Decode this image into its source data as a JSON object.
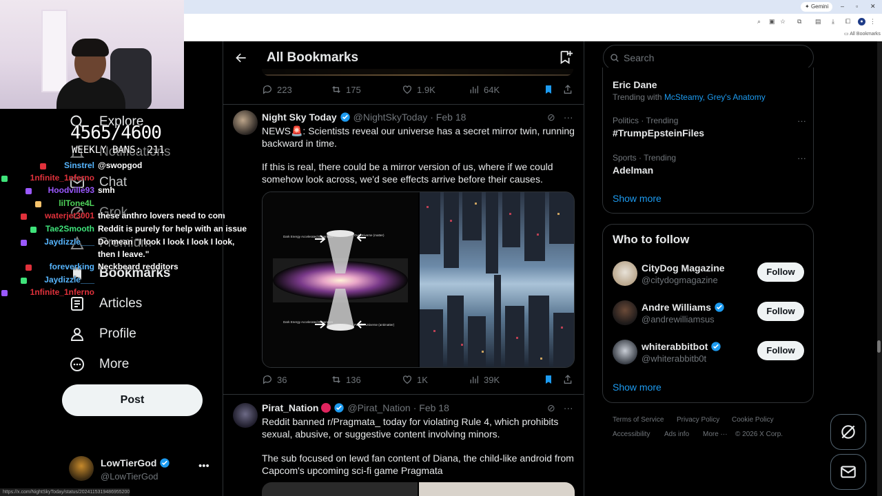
{
  "browser": {
    "gemini_label": "Gemini",
    "bookmarks_label": "All Bookmarks"
  },
  "overlay": {
    "counter": "4565/4600",
    "weekly": "WEEKLY BANS: 211"
  },
  "chat": [
    {
      "user": "Sinstrel",
      "user_color": "#57b6ff",
      "msg": "@swopgod"
    },
    {
      "user": "1nfinite_1nferno",
      "user_color": "#e0313b",
      "msg": ""
    },
    {
      "user": "Hoodville93",
      "user_color": "#9b59ff",
      "msg": "smh"
    },
    {
      "user": "lilTone4L",
      "user_color": "#4fd35a",
      "msg": ""
    },
    {
      "user": "waterjet3001",
      "user_color": "#e0313b",
      "msg": "these anthro lovers need to com"
    },
    {
      "user": "Tae2Smooth",
      "user_color": "#3fe37a",
      "msg": "Reddit is purely for help with an issue"
    },
    {
      "user": "Jaydizzle___",
      "user_color": "#57b6ff",
      "msg": "Do mean \"I look I look I look I look,"
    },
    {
      "user": "",
      "user_color": "#ffffff",
      "msg": "then I leave.\""
    },
    {
      "user": "foreverking",
      "user_color": "#57b6ff",
      "msg": "Neckbeard redditors"
    },
    {
      "user": "Jaydizzle___",
      "user_color": "#57b6ff",
      "msg": ""
    },
    {
      "user": "1nfinite_1nferno",
      "user_color": "#e0313b",
      "msg": ""
    }
  ],
  "nav": {
    "explore": "Explore",
    "notifications": "Notifications",
    "chat": "Chat",
    "grok": "Grok",
    "premium": "Premium",
    "bookmarks": "Bookmarks",
    "articles": "Articles",
    "profile": "Profile",
    "more": "More",
    "post": "Post"
  },
  "account": {
    "name": "LowTierGod",
    "handle": "@LowTierGod"
  },
  "timeline": {
    "title": "All Bookmarks",
    "prev_actions": {
      "replies": "223",
      "reposts": "175",
      "likes": "1.9K",
      "views": "64K"
    },
    "tweets": [
      {
        "name": "Night Sky Today",
        "handle": "@NightSkyToday",
        "date": "· Feb 18",
        "para1": "NEWS🚨: Scientists reveal our universe has a secret mirror twin, running backward in time.",
        "para2": "If this is real, there could be a mirror version of us, where if we could somehow look across, we'd see effects arrive before their causes.",
        "media_labels": {
          "top_left": "Dark Energy Accelerated Expansion",
          "top_right": "Our Universe (matter)",
          "bottom_left": "Dark Energy Accelerated Expansion",
          "bottom_right": "Parallel Universe (antimatter)"
        },
        "actions": {
          "replies": "36",
          "reposts": "136",
          "likes": "1K",
          "views": "39K"
        }
      },
      {
        "name": "Pirat_Nation",
        "handle": "@Pirat_Nation",
        "date": "· Feb 18",
        "para1": "Reddit banned r/Pragmata_ today for violating Rule 4, which prohibits sexual, abusive, or suggestive content involving minors.",
        "para2": "The sub focused on lewd fan content of Diana, the child-like android from Capcom's upcoming sci-fi game Pragmata"
      }
    ]
  },
  "search": {
    "placeholder": "Search"
  },
  "trends": [
    {
      "meta": "",
      "title": "Eric Dane",
      "with_prefix": "Trending with ",
      "with_links": "McSteamy, Grey's Anatomy"
    },
    {
      "meta": "Politics · Trending",
      "title": "#TrumpEpsteinFiles"
    },
    {
      "meta": "Sports · Trending",
      "title": "Adelman"
    }
  ],
  "show_more": "Show more",
  "who_to_follow": {
    "title": "Who to follow",
    "accounts": [
      {
        "name": "CityDog Magazine",
        "handle": "@citydogmagazine",
        "verified": false
      },
      {
        "name": "Andre Williams",
        "handle": "@andrewilliamsus",
        "verified": true
      },
      {
        "name": "whiterabbitbot",
        "handle": "@whiterabbitb0t",
        "verified": true
      }
    ],
    "follow_label": "Follow",
    "show_more": "Show more"
  },
  "footer": {
    "terms": "Terms of Service",
    "privacy": "Privacy Policy",
    "cookie": "Cookie Policy",
    "accessibility": "Accessibility",
    "ads": "Ads info",
    "more": "More ···",
    "copyright": "© 2026 X Corp."
  },
  "status_url": "https://x.com/NightSkyToday/status/2024115319486955200/photo/2",
  "colors": {
    "accent": "#1d9bf0",
    "background": "#000000",
    "border": "#2f3336",
    "muted": "#71767b"
  }
}
